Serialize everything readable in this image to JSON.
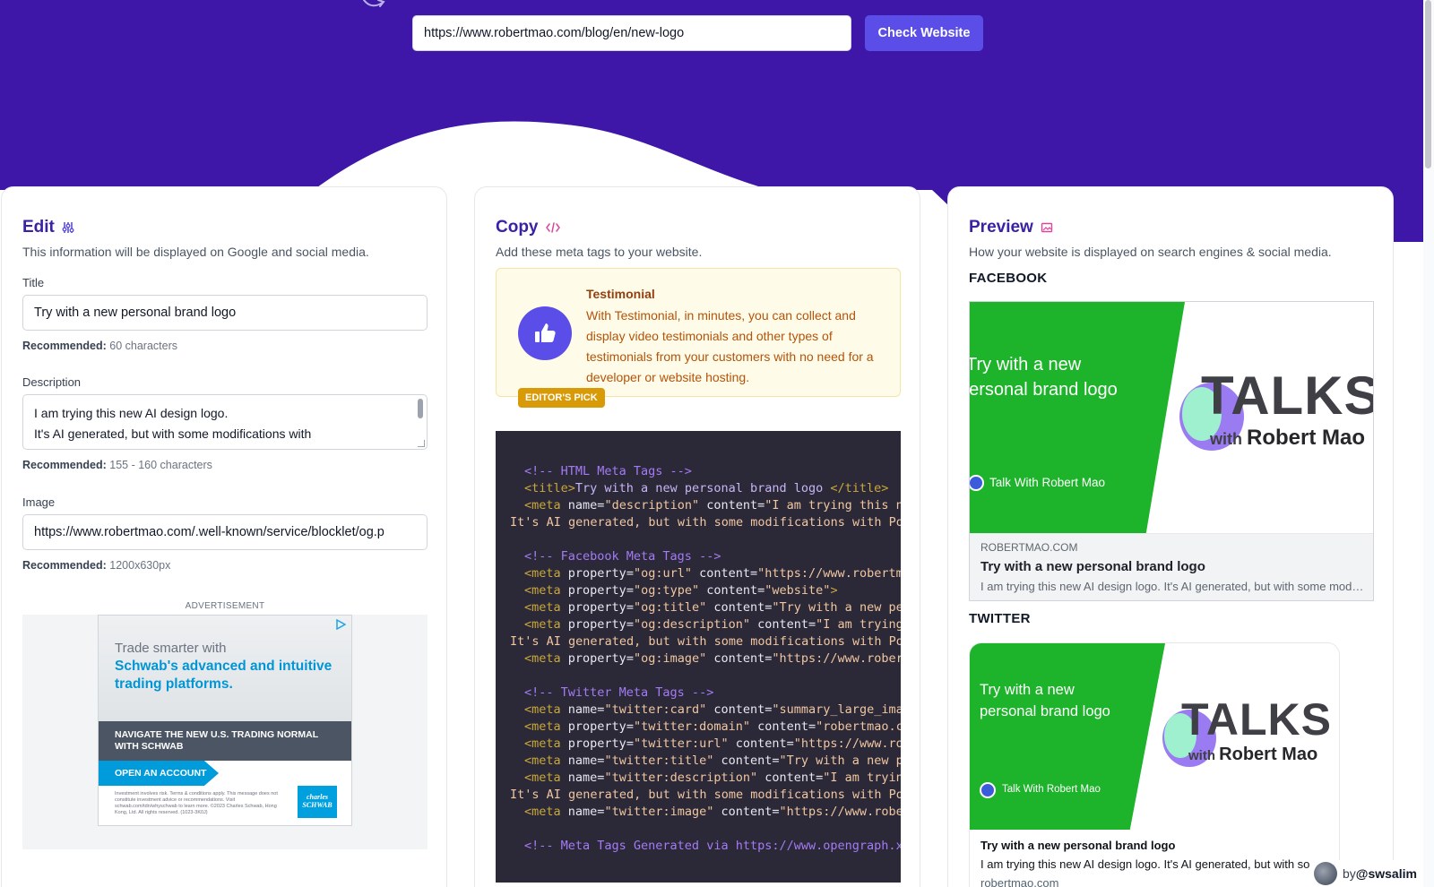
{
  "header": {
    "url_value": "https://www.robertmao.com/blog/en/new-logo",
    "check_label": "Check Website"
  },
  "edit": {
    "title": "Edit",
    "subtitle": "This information will be displayed on Google and social media.",
    "title_label": "Title",
    "title_value": "Try with a new personal brand logo",
    "title_reco_label": "Recommended:",
    "title_reco_value": "60 characters",
    "desc_label": "Description",
    "desc_line1": "I am trying this new AI design logo.",
    "desc_line2": "It's AI generated, but with some modifications with",
    "desc_reco_label": "Recommended:",
    "desc_reco_value": "155 - 160 characters",
    "image_label": "Image",
    "image_value": "https://www.robertmao.com/.well-known/service/blocklet/og.p",
    "image_reco_label": "Recommended:",
    "image_reco_value": "1200x630px",
    "icon": "sliders-icon"
  },
  "ad": {
    "label": "ADVERTISEMENT",
    "line1": "Trade smarter with",
    "line2": "Schwab's advanced and intuitive trading platforms.",
    "band": "NAVIGATE THE NEW U.S. TRADING NORMAL WITH SCHWAB",
    "cta": "OPEN AN ACCOUNT",
    "fine": "Investment involves risk. Terms & conditions apply. This message does not constitute investment advice or recommendations. Visit schwab.com/tdn/whyschwab to learn more. ©2023 Charles Schwab, Hong Kong, Ltd. All rights reserved. (1023-3K0J)",
    "logo": "charles SCHWAB"
  },
  "copy": {
    "title": "Copy",
    "subtitle": "Add these meta tags to your website.",
    "icon": "code-icon",
    "testimonial": {
      "title": "Testimonial",
      "text": "With Testimonial, in minutes, you can collect and display video testimonials and other types of testimonials from your customers with no need for a developer or website hosting.",
      "badge": "EDITOR'S PICK",
      "icon": "thumbs-up-icon"
    },
    "code_lines": [
      {
        "indent": true,
        "parts": [
          [
            "com",
            "<!-- HTML Meta Tags -->"
          ]
        ]
      },
      {
        "indent": true,
        "parts": [
          [
            "tag",
            "<title>"
          ],
          [
            "txt",
            "Try with a new personal brand logo "
          ],
          [
            "tag",
            "</title>"
          ]
        ]
      },
      {
        "indent": true,
        "parts": [
          [
            "tag",
            "<meta "
          ],
          [
            "attr",
            "name"
          ],
          [
            "plain",
            "="
          ],
          [
            "str",
            "\"description\""
          ],
          [
            "attr",
            " content"
          ],
          [
            "plain",
            "="
          ],
          [
            "str",
            "\"I am trying this new AI design logo."
          ]
        ]
      },
      {
        "indent": false,
        "parts": [
          [
            "str",
            "It's AI generated, but with some modifications with PowerPoint"
          ]
        ]
      },
      {
        "indent": true,
        "parts": []
      },
      {
        "indent": true,
        "parts": [
          [
            "com",
            "<!-- Facebook Meta Tags -->"
          ]
        ]
      },
      {
        "indent": true,
        "parts": [
          [
            "tag",
            "<meta "
          ],
          [
            "attr",
            "property"
          ],
          [
            "plain",
            "="
          ],
          [
            "str",
            "\"og:url\""
          ],
          [
            "attr",
            " content"
          ],
          [
            "plain",
            "="
          ],
          [
            "str",
            "\"https://www.robertmao.com/blog/en/new-logo\""
          ]
        ]
      },
      {
        "indent": true,
        "parts": [
          [
            "tag",
            "<meta "
          ],
          [
            "attr",
            "property"
          ],
          [
            "plain",
            "="
          ],
          [
            "str",
            "\"og:type\""
          ],
          [
            "attr",
            " content"
          ],
          [
            "plain",
            "="
          ],
          [
            "str",
            "\"website\""
          ],
          [
            "tag",
            ">"
          ]
        ]
      },
      {
        "indent": true,
        "parts": [
          [
            "tag",
            "<meta "
          ],
          [
            "attr",
            "property"
          ],
          [
            "plain",
            "="
          ],
          [
            "str",
            "\"og:title\""
          ],
          [
            "attr",
            " content"
          ],
          [
            "plain",
            "="
          ],
          [
            "str",
            "\"Try with a new personal brand logo\""
          ]
        ]
      },
      {
        "indent": true,
        "parts": [
          [
            "tag",
            "<meta "
          ],
          [
            "attr",
            "property"
          ],
          [
            "plain",
            "="
          ],
          [
            "str",
            "\"og:description\""
          ],
          [
            "attr",
            " content"
          ],
          [
            "plain",
            "="
          ],
          [
            "str",
            "\"I am trying this new AI design logo."
          ]
        ]
      },
      {
        "indent": false,
        "parts": [
          [
            "str",
            "It's AI generated, but with some modifications with PowerPoint"
          ]
        ]
      },
      {
        "indent": true,
        "parts": [
          [
            "tag",
            "<meta "
          ],
          [
            "attr",
            "property"
          ],
          [
            "plain",
            "="
          ],
          [
            "str",
            "\"og:image\""
          ],
          [
            "attr",
            " content"
          ],
          [
            "plain",
            "="
          ],
          [
            "str",
            "\"https://www.robertmao.com/.well-known\""
          ]
        ]
      },
      {
        "indent": true,
        "parts": []
      },
      {
        "indent": true,
        "parts": [
          [
            "com",
            "<!-- Twitter Meta Tags -->"
          ]
        ]
      },
      {
        "indent": true,
        "parts": [
          [
            "tag",
            "<meta "
          ],
          [
            "attr",
            "name"
          ],
          [
            "plain",
            "="
          ],
          [
            "str",
            "\"twitter:card\""
          ],
          [
            "attr",
            " content"
          ],
          [
            "plain",
            "="
          ],
          [
            "str",
            "\"summary_large_image\""
          ]
        ]
      },
      {
        "indent": true,
        "parts": [
          [
            "tag",
            "<meta "
          ],
          [
            "attr",
            "property"
          ],
          [
            "plain",
            "="
          ],
          [
            "str",
            "\"twitter:domain\""
          ],
          [
            "attr",
            " content"
          ],
          [
            "plain",
            "="
          ],
          [
            "str",
            "\"robertmao.com\""
          ]
        ]
      },
      {
        "indent": true,
        "parts": [
          [
            "tag",
            "<meta "
          ],
          [
            "attr",
            "property"
          ],
          [
            "plain",
            "="
          ],
          [
            "str",
            "\"twitter:url\""
          ],
          [
            "attr",
            " content"
          ],
          [
            "plain",
            "="
          ],
          [
            "str",
            "\"https://www.robertmao.com/blog\""
          ]
        ]
      },
      {
        "indent": true,
        "parts": [
          [
            "tag",
            "<meta "
          ],
          [
            "attr",
            "name"
          ],
          [
            "plain",
            "="
          ],
          [
            "str",
            "\"twitter:title\""
          ],
          [
            "attr",
            " content"
          ],
          [
            "plain",
            "="
          ],
          [
            "str",
            "\"Try with a new personal brand logo\""
          ]
        ]
      },
      {
        "indent": true,
        "parts": [
          [
            "tag",
            "<meta "
          ],
          [
            "attr",
            "name"
          ],
          [
            "plain",
            "="
          ],
          [
            "str",
            "\"twitter:description\""
          ],
          [
            "attr",
            " content"
          ],
          [
            "plain",
            "="
          ],
          [
            "str",
            "\"I am trying this new AI design logo."
          ]
        ]
      },
      {
        "indent": false,
        "parts": [
          [
            "str",
            "It's AI generated, but with some modifications with PowerPoint"
          ]
        ]
      },
      {
        "indent": true,
        "parts": [
          [
            "tag",
            "<meta "
          ],
          [
            "attr",
            "name"
          ],
          [
            "plain",
            "="
          ],
          [
            "str",
            "\"twitter:image\""
          ],
          [
            "attr",
            " content"
          ],
          [
            "plain",
            "="
          ],
          [
            "str",
            "\"https://www.robertmao.com/.well-known\""
          ]
        ]
      },
      {
        "indent": true,
        "parts": []
      },
      {
        "indent": true,
        "parts": [
          [
            "com",
            "<!-- Meta Tags Generated via https://www.opengraph.xyz -->"
          ]
        ]
      }
    ]
  },
  "preview": {
    "title": "Preview",
    "subtitle": "How your website is displayed on search engines & social media.",
    "icon": "image-icon",
    "facebook_label": "FACEBOOK",
    "twitter_label": "TWITTER",
    "og_title_line1": "Try with a new",
    "og_title_line2": "personal brand logo",
    "og_handle": "Talk With Robert Mao",
    "og_talks": "TALKS",
    "og_with": "with",
    "og_name": "Robert Mao",
    "fb_domain": "ROBERTMAO.COM",
    "fb_title": "Try with a new personal brand logo",
    "fb_desc": "I am trying this new AI design logo. It's AI generated, but with some modifications with PowerPoint",
    "tw_title": "Try with a new personal brand logo",
    "tw_desc": "I am trying this new AI design logo. It's AI generated, but with some modifications",
    "tw_domain": "robertmao.com"
  },
  "byline": {
    "prefix": "by",
    "handle": "@swsalim"
  },
  "colors": {
    "hero": "#3e16a8",
    "accent": "#5b4ee8",
    "og_green": "#1db32a",
    "code_bg": "#2b2838"
  }
}
